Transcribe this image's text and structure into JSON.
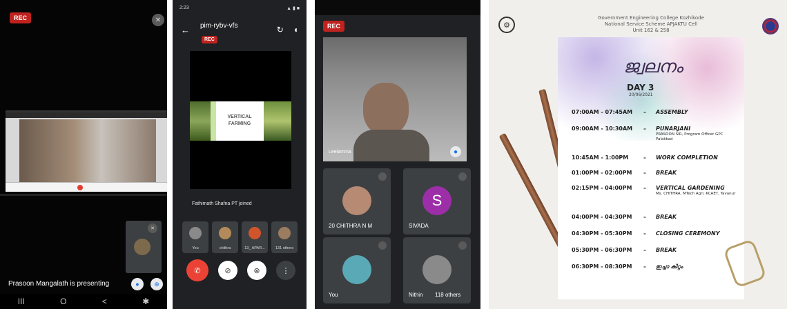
{
  "panel1": {
    "rec": "REC",
    "presenting": "Prasoon Mangalath is presenting",
    "nav": [
      "III",
      "O",
      "<",
      "✱"
    ]
  },
  "panel2": {
    "status_left": "2:23",
    "status_right": "",
    "meeting_code": "pim-rybv-vfs",
    "rec": "REC",
    "slide_text": "VERTICAL\nFARMING",
    "joined": "Fathimath Shafna PT joined",
    "tiles": [
      "You",
      "chithra",
      "13_ APAR...",
      "131 others"
    ]
  },
  "panel3": {
    "rec": "REC",
    "speaker": "Leelamma",
    "tiles": [
      {
        "name": "20 CHITHRA N M",
        "initial": ""
      },
      {
        "name": "SIVADA",
        "initial": "S"
      },
      {
        "name": "You",
        "initial": ""
      },
      {
        "name": "Nithin",
        "initial": ""
      }
    ],
    "others": "118 others"
  },
  "poster": {
    "header_line1": "Government Engineering College Kozhikode",
    "header_line2": "National Service Scheme APJAKTU Cell",
    "header_line3": "Unit 162 & 258",
    "title": "ജ്വലനം",
    "day": "DAY 3",
    "date": "20/06/2021",
    "schedule": [
      {
        "time": "07:00AM - 07:45AM",
        "event": "ASSEMBLY",
        "sub": ""
      },
      {
        "time": "09:00AM - 10:30AM",
        "event": "PUNARJANI",
        "sub": "PRASOON SIR, Program Officer GPC Palakkad"
      },
      {
        "time": "10:45AM - 1:00PM",
        "event": "WORK COMPLETION",
        "sub": ""
      },
      {
        "time": "01:00PM - 02:00PM",
        "event": "BREAK",
        "sub": ""
      },
      {
        "time": "02:15PM - 04:00PM",
        "event": "VERTICAL GARDENING",
        "sub": "Ms. CHITHRA, MTech Agri. KCAET, Tavanur"
      },
      {
        "time": "04:00PM - 04:30PM",
        "event": "BREAK",
        "sub": ""
      },
      {
        "time": "04:30PM - 05:30PM",
        "event": "CLOSING CEREMONY",
        "sub": ""
      },
      {
        "time": "05:30PM - 06:30PM",
        "event": "BREAK",
        "sub": ""
      },
      {
        "time": "06:30PM - 08:30PM",
        "event": "ഇച്ചാ കിറ്റം",
        "sub": ""
      }
    ]
  }
}
